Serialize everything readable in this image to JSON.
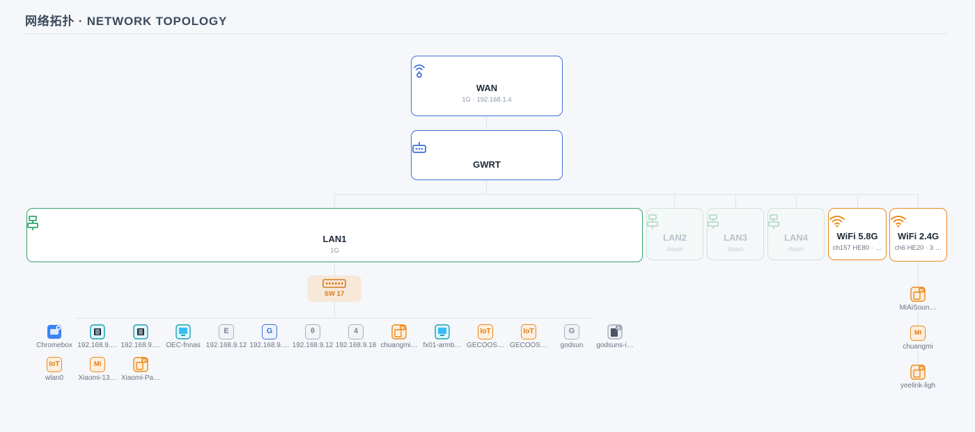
{
  "title": "网络拓扑 · NETWORK TOPOLOGY",
  "wan": {
    "label": "WAN",
    "sub": "1G · 192.168.1.4"
  },
  "router": {
    "label": "GWRT"
  },
  "ports": [
    {
      "label": "LAN1",
      "sub": "1G"
    },
    {
      "label": "LAN2",
      "sub": "down"
    },
    {
      "label": "LAN3",
      "sub": "down"
    },
    {
      "label": "LAN4",
      "sub": "down"
    },
    {
      "label": "WiFi 5.8G",
      "sub": "ch157 HE80 · …"
    },
    {
      "label": "WiFi 2.4G",
      "sub": "ch6 HE20 · 3 …"
    }
  ],
  "switch": {
    "label": "SW 17"
  },
  "lan_devices": [
    {
      "label": "Chromebox",
      "icon": "chromebox-icon",
      "glyph": ""
    },
    {
      "label": "192.168.9.…",
      "icon": "board-icon",
      "glyph": ""
    },
    {
      "label": "192.168.9.…",
      "icon": "board-icon",
      "glyph": ""
    },
    {
      "label": "OEC-fnnas",
      "icon": "monitor-icon",
      "glyph": ""
    },
    {
      "label": "192.168.9.12",
      "icon": "letter-icon",
      "glyph": "E"
    },
    {
      "label": "192.168.9.…",
      "icon": "letter-icon",
      "glyph": "G"
    },
    {
      "label": "192.168.9.12",
      "icon": "letter-icon",
      "glyph": "θ"
    },
    {
      "label": "192.168.9.18",
      "icon": "letter-icon",
      "glyph": "4"
    },
    {
      "label": "chuangmi…",
      "icon": "mi-device-icon",
      "glyph": "MI"
    },
    {
      "label": "fx01-armb…",
      "icon": "monitor-icon",
      "glyph": ""
    },
    {
      "label": "GECOOS…",
      "icon": "iot-icon",
      "glyph": "IoT"
    },
    {
      "label": "GECOOS…",
      "icon": "iot-icon",
      "glyph": "IoT"
    },
    {
      "label": "godsun",
      "icon": "letter-icon",
      "glyph": "G"
    },
    {
      "label": "godsuns-i…",
      "icon": "tablet-icon",
      "glyph": "A"
    },
    {
      "label": "wlan0",
      "icon": "iot-icon",
      "glyph": "IoT"
    },
    {
      "label": "Xiaomi-13…",
      "icon": "mi-icon",
      "glyph": "MI"
    },
    {
      "label": "Xiaomi-Pa…",
      "icon": "mi-device-icon",
      "glyph": "MI"
    }
  ],
  "wifi_devices": [
    {
      "label": "MiAiSoun…",
      "icon": "mi-device-icon",
      "glyph": "MI"
    },
    {
      "label": "chuangmi",
      "icon": "mi-icon",
      "glyph": "MI"
    },
    {
      "label": "yeelink-ligh",
      "icon": "mi-device-icon",
      "glyph": "MI"
    }
  ],
  "colors": {
    "blue": "#3d6fd6",
    "green": "#2fa56a",
    "orange": "#ea8a1b",
    "teal": "#1aa0b3",
    "gray": "#8b95a3"
  }
}
